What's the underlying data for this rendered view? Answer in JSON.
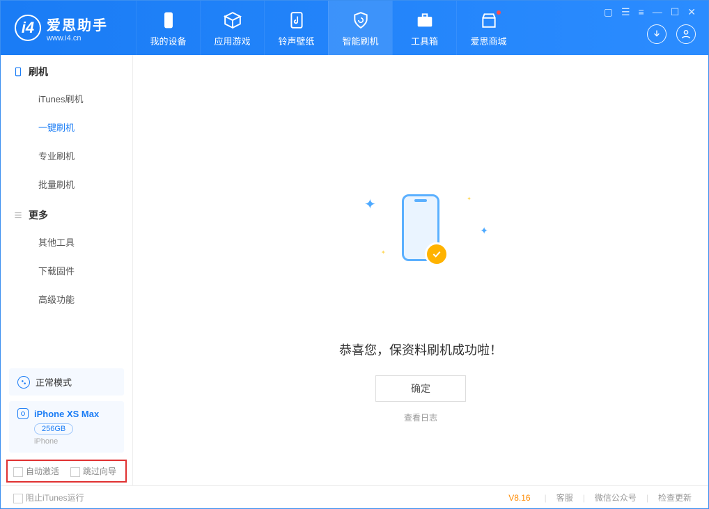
{
  "app": {
    "title": "爱思助手",
    "subtitle": "www.i4.cn"
  },
  "tabs": [
    {
      "label": "我的设备"
    },
    {
      "label": "应用游戏"
    },
    {
      "label": "铃声壁纸"
    },
    {
      "label": "智能刷机"
    },
    {
      "label": "工具箱"
    },
    {
      "label": "爱思商城"
    }
  ],
  "sidebar": {
    "section1": {
      "title": "刷机",
      "items": [
        "iTunes刷机",
        "一键刷机",
        "专业刷机",
        "批量刷机"
      ]
    },
    "section2": {
      "title": "更多",
      "items": [
        "其他工具",
        "下载固件",
        "高级功能"
      ]
    }
  },
  "mode": {
    "label": "正常模式"
  },
  "device": {
    "name": "iPhone XS Max",
    "capacity": "256GB",
    "type": "iPhone"
  },
  "options": {
    "auto_activate": "自动激活",
    "skip_guide": "跳过向导"
  },
  "main": {
    "success_message": "恭喜您，保资料刷机成功啦！",
    "ok_button": "确定",
    "log_link": "查看日志"
  },
  "footer": {
    "block_itunes": "阻止iTunes运行",
    "version": "V8.16",
    "links": [
      "客服",
      "微信公众号",
      "检查更新"
    ]
  }
}
